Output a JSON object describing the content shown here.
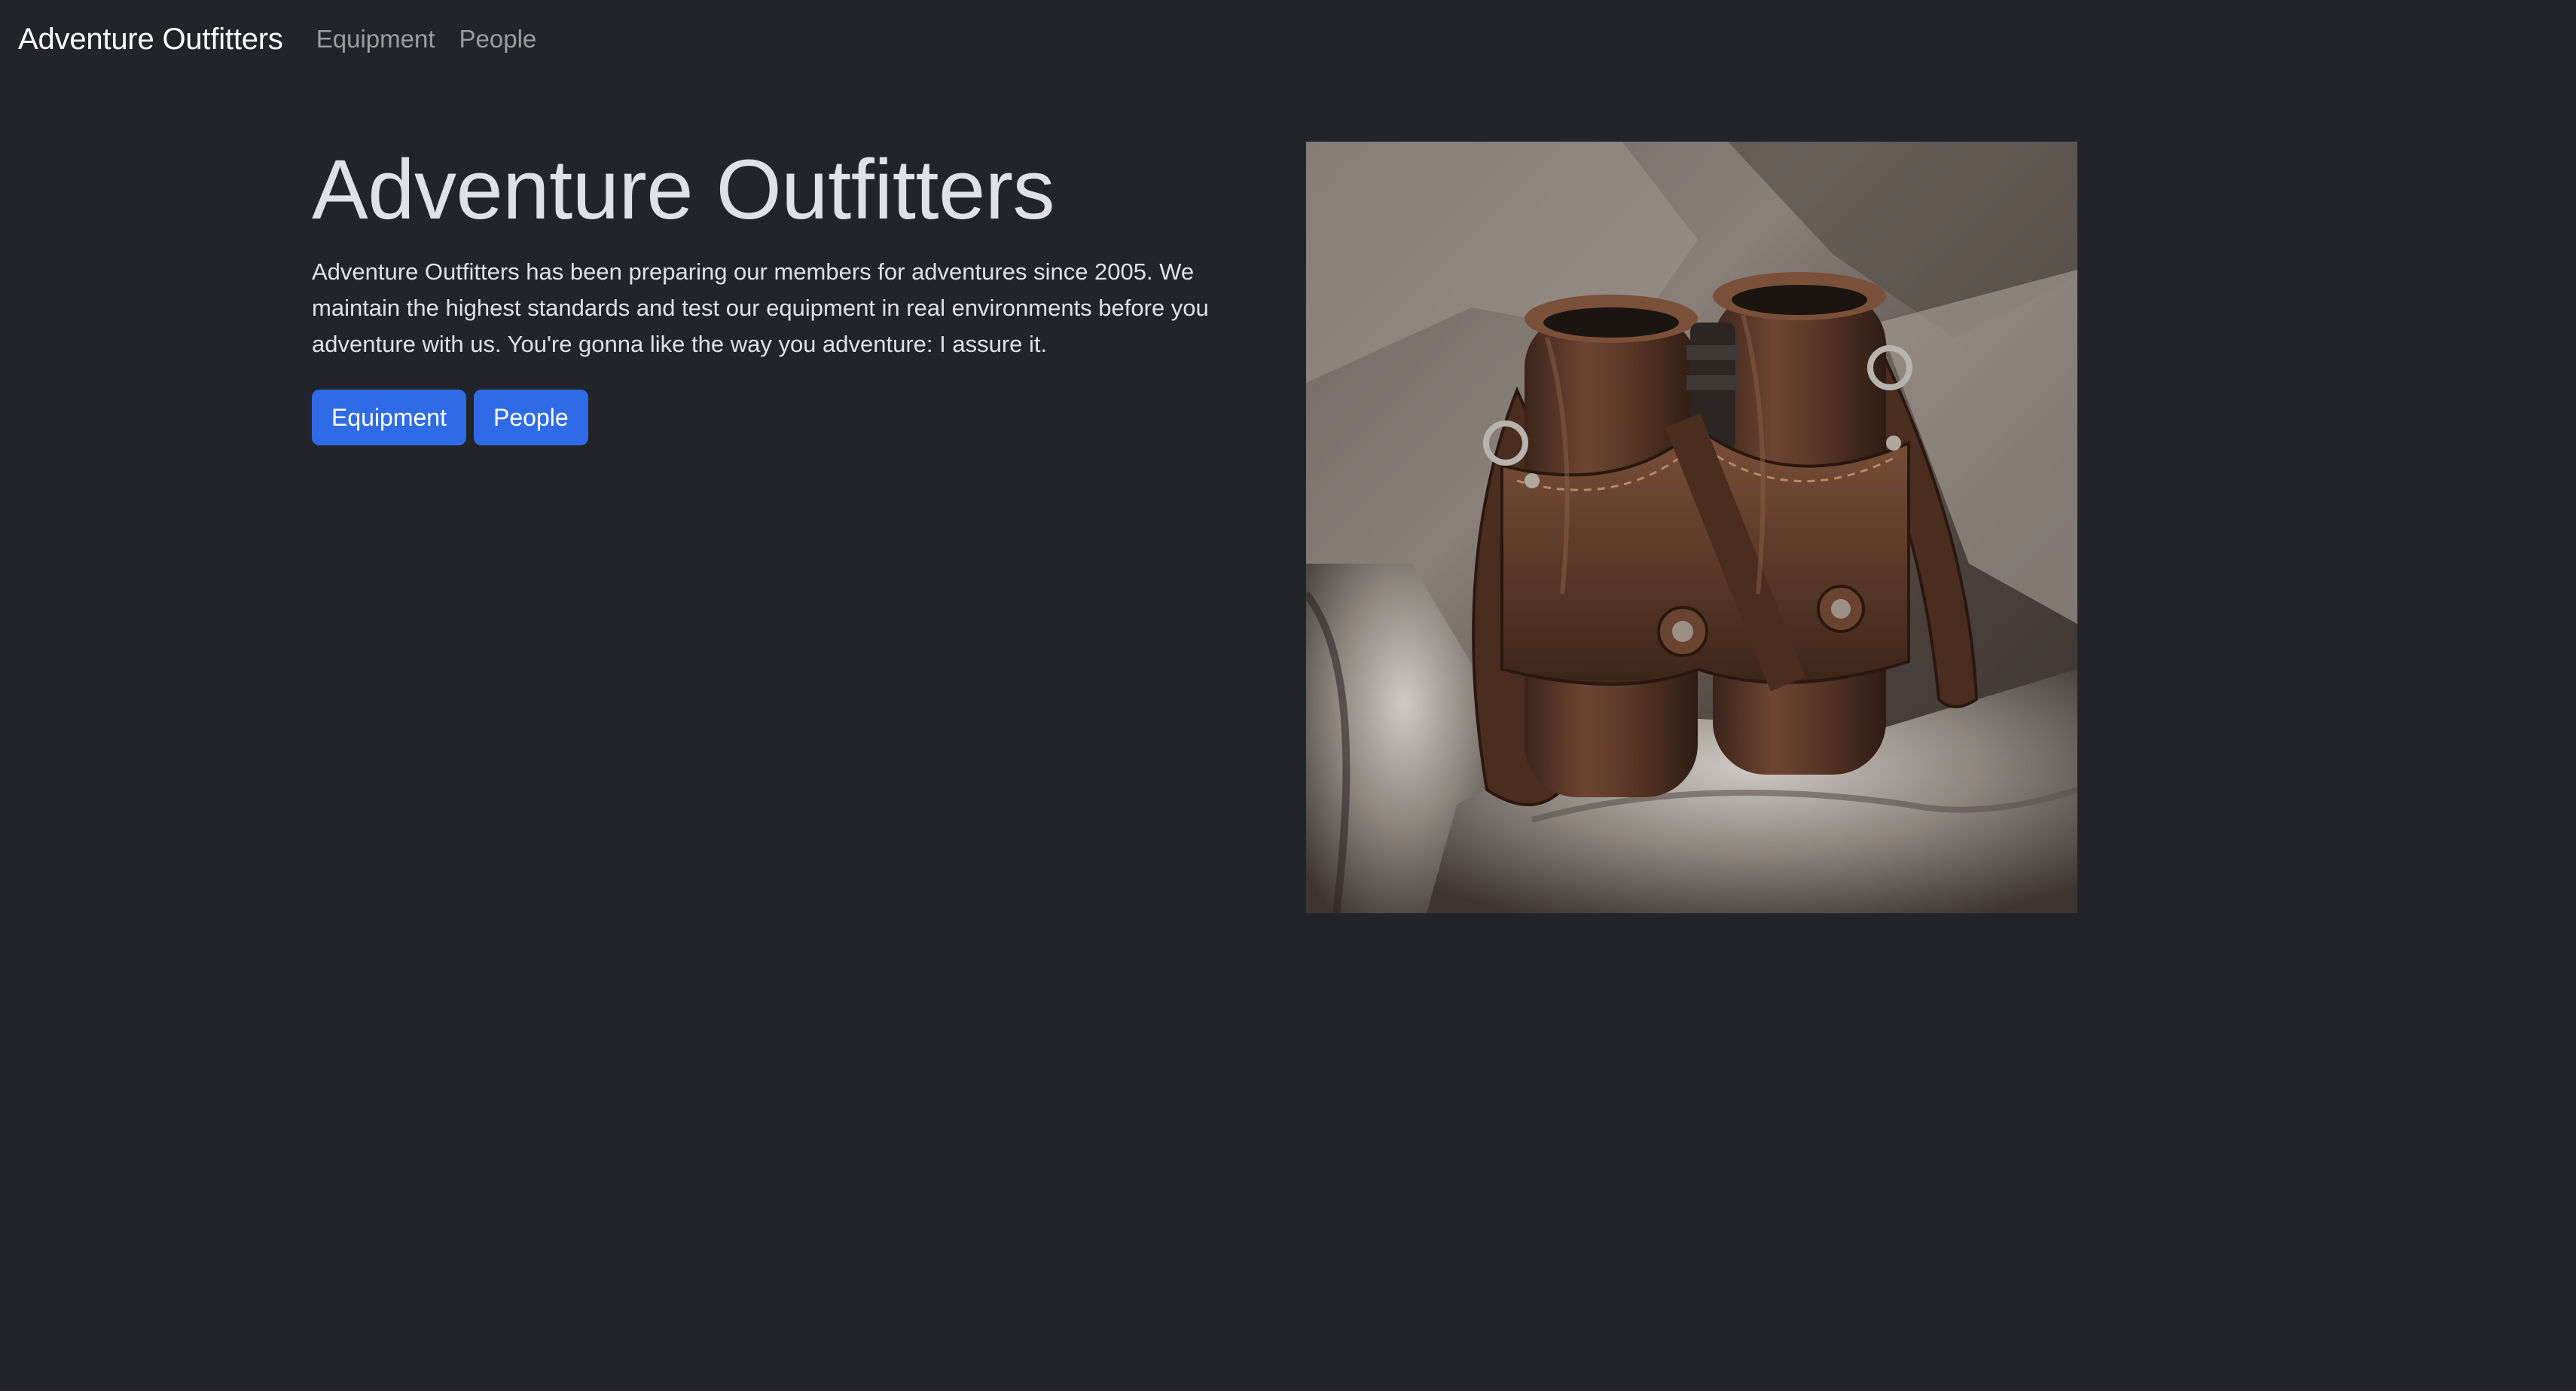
{
  "navbar": {
    "brand": "Adventure Outfitters",
    "links": [
      {
        "label": "Equipment"
      },
      {
        "label": "People"
      }
    ]
  },
  "hero": {
    "title": "Adventure Outfitters",
    "description": "Adventure Outfitters has been preparing our members for adventures since 2005. We maintain the highest standards and test our equipment in real environments before you adventure with us. You're gonna like the way you adventure: I assure it.",
    "buttons": [
      {
        "label": "Equipment"
      },
      {
        "label": "People"
      }
    ]
  },
  "image": {
    "subject": "leather-binoculars-on-rock"
  },
  "colors": {
    "background": "#212529",
    "button": "#2f6be6",
    "brand_text": "#ffffff",
    "nav_text": "#8c8f93"
  }
}
